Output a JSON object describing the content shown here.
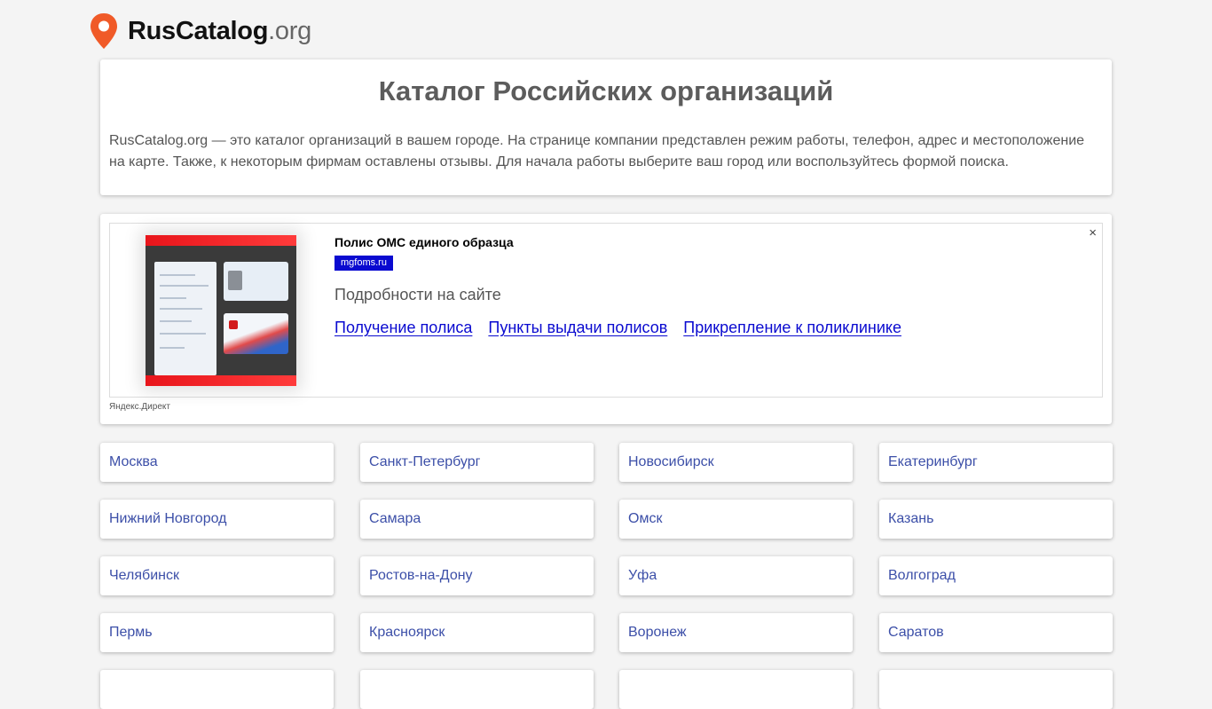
{
  "header": {
    "logo_main": "RusCatalog",
    "logo_tld": ".org",
    "pin_color": "#f05a28"
  },
  "intro": {
    "title": "Каталог Российских организаций",
    "text": "RusCatalog.org — это каталог организаций в вашем городе. На странице компании представлен режим работы, телефон, адрес и местоположение на карте. Также, к некоторым фирмам оставлены отзывы. Для начала работы выберите ваш город или воспользуйтесь формой поиска."
  },
  "ad": {
    "title": "Полис ОМС единого образца",
    "domain": "mgfoms.ru",
    "description": "Подробности на сайте",
    "links": [
      "Получение полиса",
      "Пункты выдачи полисов",
      "Прикрепление к поликлинике"
    ],
    "close": "×",
    "label": "Яндекс.Директ"
  },
  "cities": [
    "Москва",
    "Санкт-Петербург",
    "Новосибирск",
    "Екатеринбург",
    "Нижний Новгород",
    "Самара",
    "Омск",
    "Казань",
    "Челябинск",
    "Ростов-на-Дону",
    "Уфа",
    "Волгоград",
    "Пермь",
    "Красноярск",
    "Воронеж",
    "Саратов",
    "",
    "",
    "",
    ""
  ]
}
